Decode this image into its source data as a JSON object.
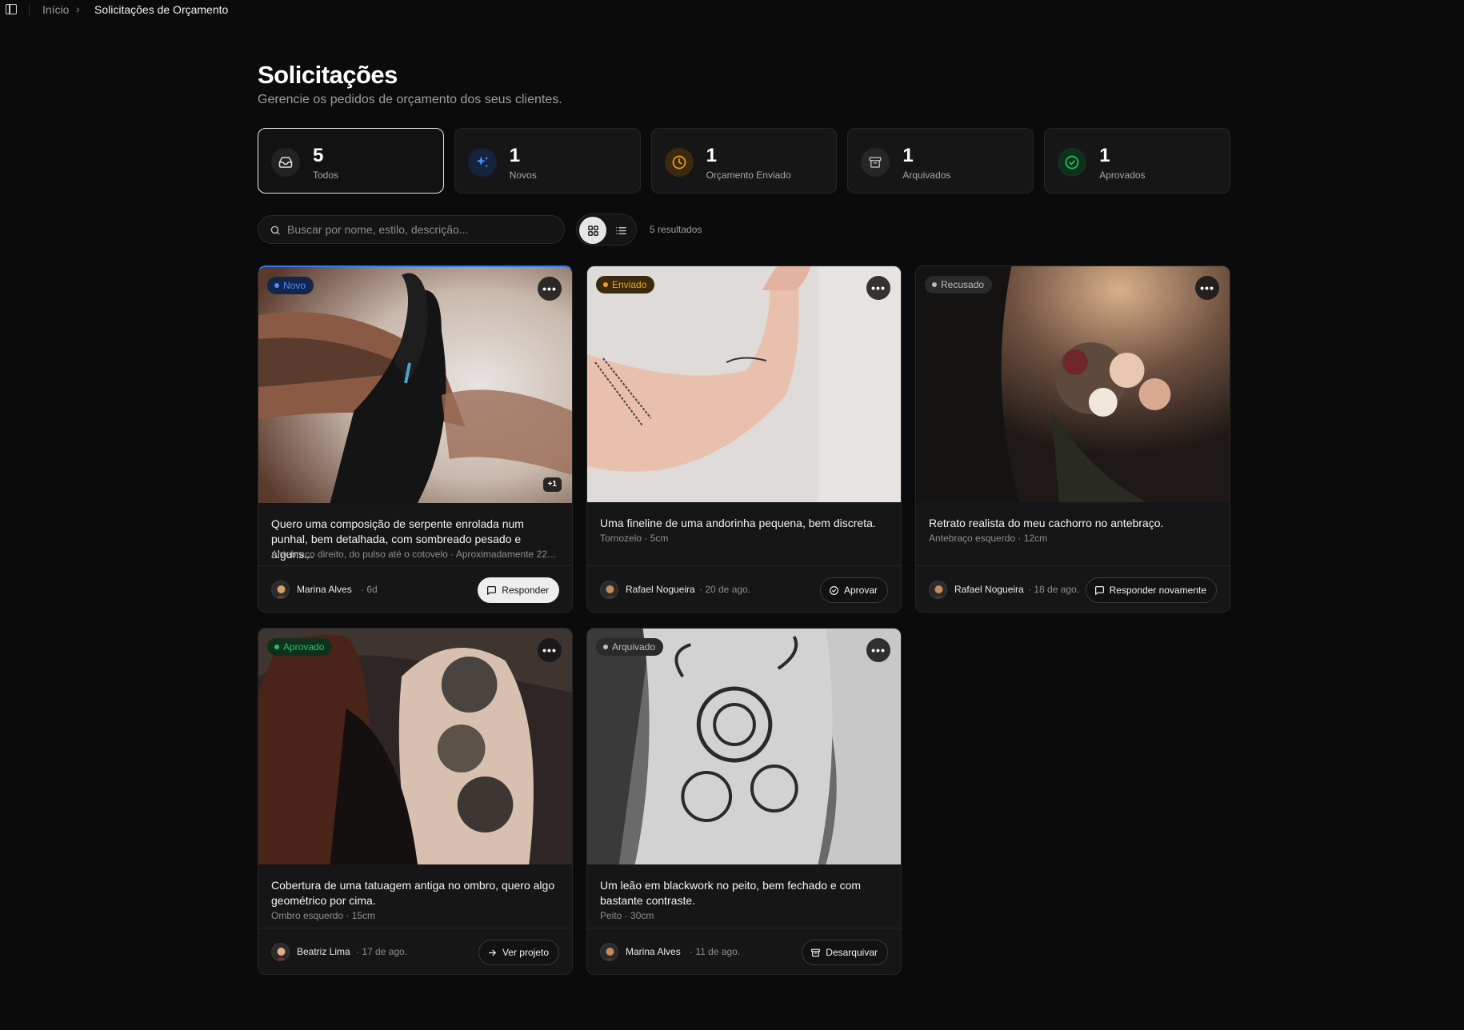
{
  "breadcrumb": {
    "home": "Início",
    "separator": "›",
    "current": "Solicitações de Orçamento"
  },
  "header": {
    "title": "Solicitações",
    "subtitle": "Gerencie os pedidos de orçamento dos seus clientes."
  },
  "stats": [
    {
      "value": "5",
      "label": "Todos",
      "icon": "inbox-icon",
      "color": "#d8d8d8",
      "bg": "#222222"
    },
    {
      "value": "1",
      "label": "Novos",
      "icon": "sparkles-icon",
      "color": "#4b8dff",
      "bg": "#16233d"
    },
    {
      "value": "1",
      "label": "Orçamento Enviado",
      "icon": "clock-icon",
      "color": "#f0a020",
      "bg": "#3a2a10"
    },
    {
      "value": "1",
      "label": "Arquivados",
      "icon": "archive-icon",
      "color": "#a8a8a8",
      "bg": "#262626"
    },
    {
      "value": "1",
      "label": "Aprovados",
      "icon": "check-circle-icon",
      "color": "#22c55e",
      "bg": "#10301d"
    }
  ],
  "search": {
    "placeholder": "Buscar por nome, estilo, descrição..."
  },
  "results_text": "5 resultados",
  "cards": [
    {
      "status": "Novo",
      "status_color": "#4b8dff",
      "status_bg": "#13264a",
      "title": "Quero uma composição de serpente enrolada num punhal, bem detalhada, com sombreado pesado e alguns...",
      "meta": "Antebraço direito, do pulso até o cotovelo · Aproximadamente 22cm...",
      "image_count": "+1",
      "author": "Marina Alves",
      "time": "· 6d",
      "action": "Responder",
      "action_icon": "message-icon"
    },
    {
      "status": "Enviado",
      "status_color": "#f0a020",
      "status_bg": "#3a2a10",
      "title": "Uma fineline de uma andorinha pequena, bem discreta.",
      "meta": "Tornozelo · 5cm",
      "author": "Rafael Nogueira",
      "time": "· 20 de ago.",
      "action": "Aprovar",
      "action_icon": "check-circle-icon"
    },
    {
      "status": "Recusado",
      "status_color": "#bdbdbd",
      "status_bg": "#2a2a2a",
      "title": "Retrato realista do meu cachorro no antebraço.",
      "meta": "Antebraço esquerdo · 12cm",
      "author": "Rafael Nogueira",
      "time": "· 18 de ago.",
      "action": "Responder novamente",
      "action_icon": "message-icon"
    },
    {
      "status": "Aprovado",
      "status_color": "#22c55e",
      "status_bg": "#10301d",
      "title": "Cobertura de uma tatuagem antiga no ombro, quero algo geométrico por cima.",
      "meta": "Ombro esquerdo · 15cm",
      "author": "Beatriz Lima",
      "time": "· 17 de ago.",
      "action": "Ver projeto",
      "action_icon": "arrow-right-icon"
    },
    {
      "status": "Arquivado",
      "status_color": "#bdbdbd",
      "status_bg": "#2a2a2a",
      "title": "Um leão em blackwork no peito, bem fechado e com bastante contraste.",
      "meta": "Peito · 30cm",
      "author": "Marina Alves",
      "time": "· 11 de ago.",
      "action": "Desarquivar",
      "action_icon": "archive-icon"
    }
  ]
}
